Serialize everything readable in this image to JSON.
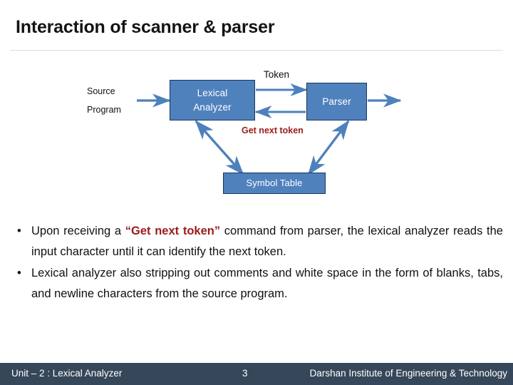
{
  "slide": {
    "title": "Interaction of scanner & parser",
    "page_number": "3"
  },
  "diagram": {
    "boxes": {
      "lexical_line1": "Lexical",
      "lexical_line2": "Analyzer",
      "parser": "Parser",
      "symbol_table": "Symbol Table"
    },
    "labels": {
      "source": "Source",
      "program": "Program",
      "token": "Token",
      "get_next_token": "Get next token"
    },
    "colors": {
      "box_fill": "#4F81BD",
      "box_border": "#17375E",
      "arrow": "#4E81BC",
      "accent_red": "#9C1A1A"
    }
  },
  "body": {
    "bullet_marker": "•",
    "bullets": [
      {
        "part1": "Upon receiving a ",
        "highlight": "“Get next token”",
        "part2": " command from parser, the lexical analyzer reads the input character until it can identify the next token."
      },
      {
        "part1": "Lexical analyzer also stripping out comments and white space in the form of blanks, tabs, and newline characters from the source program.",
        "highlight": "",
        "part2": ""
      }
    ]
  },
  "footer": {
    "left": "Unit – 2 : Lexical Analyzer",
    "page": "3",
    "right": "Darshan Institute of Engineering & Technology",
    "background": "#36475A"
  }
}
